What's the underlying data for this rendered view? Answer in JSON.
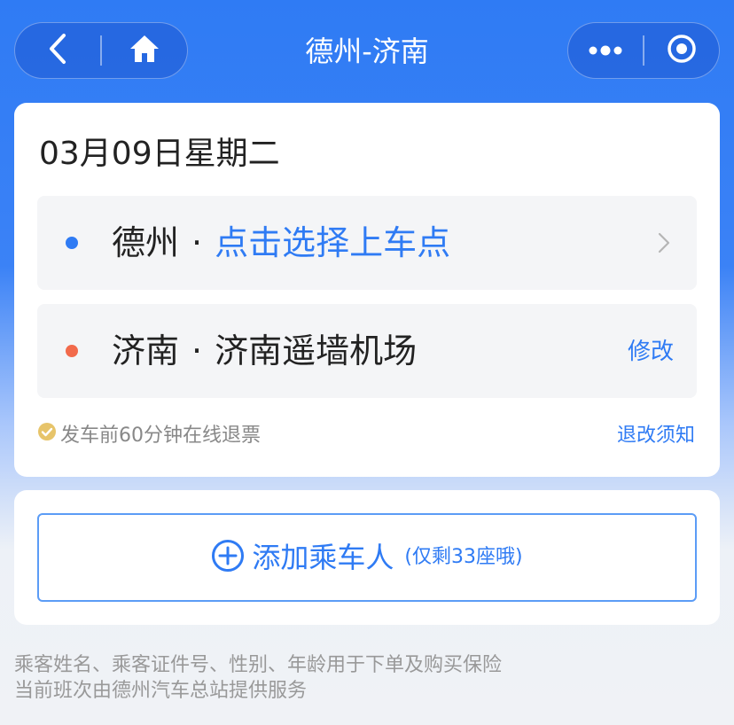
{
  "nav": {
    "title": "德州-济南",
    "icons": [
      "back-arrow-icon",
      "home-icon",
      "more-dots-icon",
      "target-icon"
    ]
  },
  "trip": {
    "date": "03月09日星期二",
    "origin": {
      "city": "德州",
      "separator": "·",
      "station": "点击选择上车点",
      "dot_color": "#2f7bf4"
    },
    "destination": {
      "city": "济南",
      "separator": "·",
      "station": "济南遥墙机场",
      "dot_color": "#f26a4b",
      "action": "修改"
    },
    "refund_note": "发车前60分钟在线退票",
    "policy_link": "退改须知"
  },
  "passenger": {
    "add_label": "添加乘车人",
    "seats_left": "(仅剩33座哦)"
  },
  "footer": {
    "line1": "乘客姓名、乘客证件号、性别、年龄用于下单及购买保险",
    "line2": "当前班次由德州汽车总站提供服务"
  },
  "colors": {
    "accent": "#2f7bf4",
    "check_badge": "#e7c46a"
  }
}
